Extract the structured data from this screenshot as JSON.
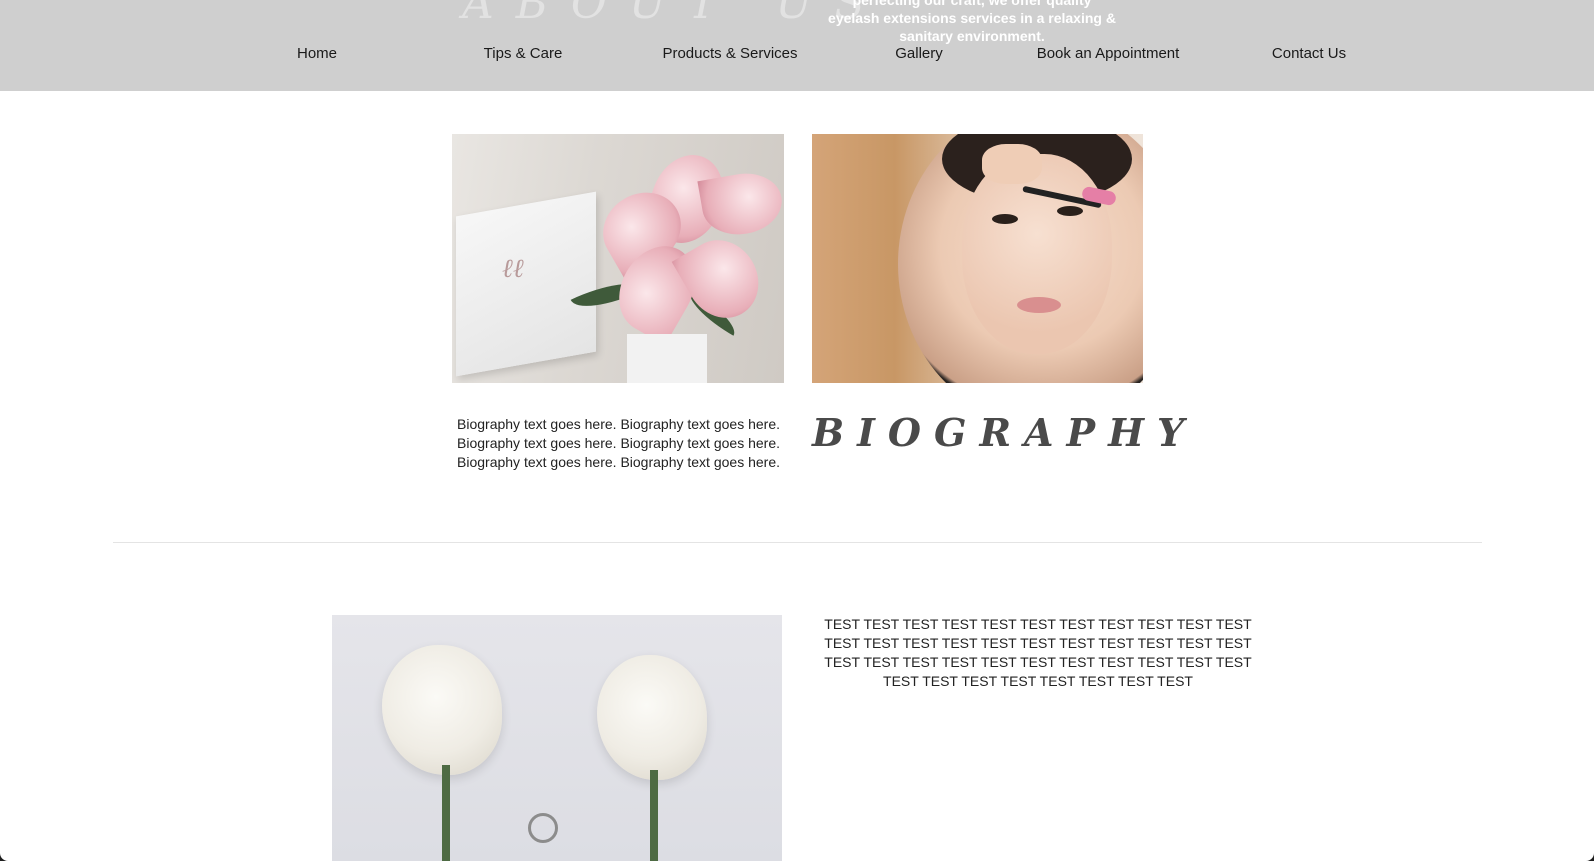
{
  "header": {
    "hero_title": "ABOUT US",
    "hero_text": "perfecting our craft, we offer quality eyelash extensions services in a relaxing & sanitary environment."
  },
  "nav": {
    "items": [
      {
        "label": "Home"
      },
      {
        "label": "Tips  &  Care"
      },
      {
        "label": "Products  &  Services"
      },
      {
        "label": "Gallery"
      },
      {
        "label": "Book an Appointment"
      },
      {
        "label": "Contact Us"
      }
    ]
  },
  "biography": {
    "heading": "BIOGRAPHY",
    "text": "Biography text goes here. Biography text goes here. Biography text goes here. Biography text goes here. Biography text goes here. Biography text goes here."
  },
  "section2": {
    "text": "TEST TEST TEST TEST TEST TEST TEST TEST TEST TEST TEST TEST TEST TEST TEST TEST TEST TEST TEST TEST TEST TEST TEST TEST TEST TEST TEST TEST TEST TEST TEST TEST TEST TEST TEST TEST TEST TEST TEST TEST TEST"
  },
  "colors": {
    "header_bg": "#cfcfcf",
    "heading_color": "#4a4a4a",
    "text_color": "#222222"
  }
}
